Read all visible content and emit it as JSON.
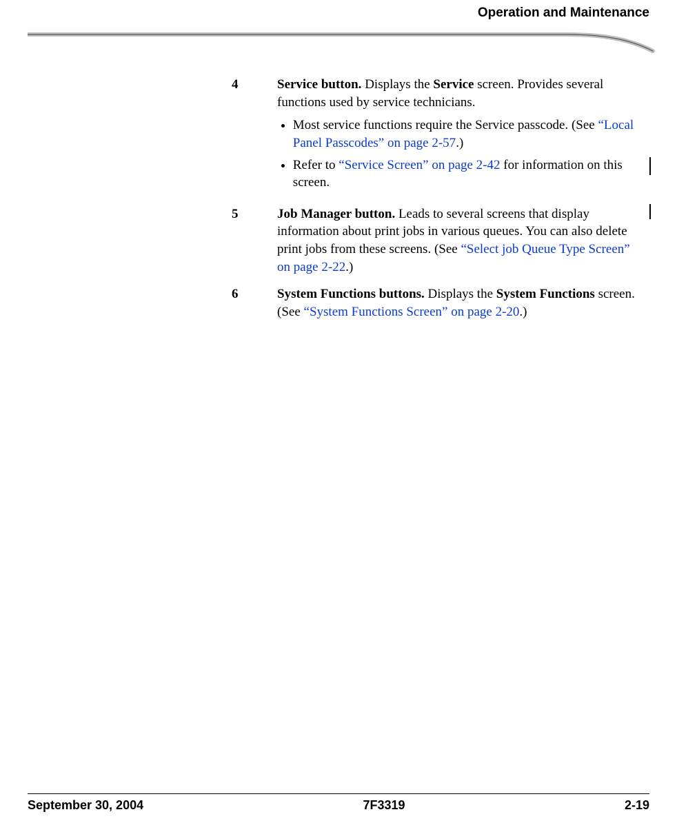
{
  "header": {
    "running_title": "Operation and Maintenance"
  },
  "items": [
    {
      "num": "4",
      "title": "Service button.",
      "body_parts": [
        {
          "t": "text",
          "v": " Displays the "
        },
        {
          "t": "bold",
          "v": "Service"
        },
        {
          "t": "text",
          "v": " screen. Provides several functions used by service technicians."
        }
      ],
      "bullets": [
        [
          {
            "t": "text",
            "v": "Most service functions require the Service passcode. (See "
          },
          {
            "t": "xref",
            "v": "“Local Panel Passcodes” on page 2-57"
          },
          {
            "t": "text",
            "v": ".)"
          }
        ],
        [
          {
            "t": "text",
            "v": "Refer to "
          },
          {
            "t": "xref",
            "v": "“Service Screen” on page 2-42"
          },
          {
            "t": "text",
            "v": " for information on this screen."
          }
        ]
      ]
    },
    {
      "num": "5",
      "title": "Job Manager button.",
      "body_parts": [
        {
          "t": "text",
          "v": " Leads to several screens that display information about print jobs in various queues. You can also delete print jobs from these screens. (See "
        },
        {
          "t": "xref",
          "v": "“Select job Queue Type Screen” on page 2-22"
        },
        {
          "t": "text",
          "v": ".)"
        }
      ],
      "bullets": []
    },
    {
      "num": "6",
      "title": "System Functions buttons.",
      "body_parts": [
        {
          "t": "text",
          "v": " Displays the "
        },
        {
          "t": "bold",
          "v": "System Functions"
        },
        {
          "t": "text",
          "v": " screen. (See "
        },
        {
          "t": "xref",
          "v": "“System Functions Screen” on page 2-20"
        },
        {
          "t": "text",
          "v": ".)"
        }
      ],
      "bullets": []
    }
  ],
  "footer": {
    "date": "September 30, 2004",
    "docnum": "7F3319",
    "page": "2-19"
  }
}
